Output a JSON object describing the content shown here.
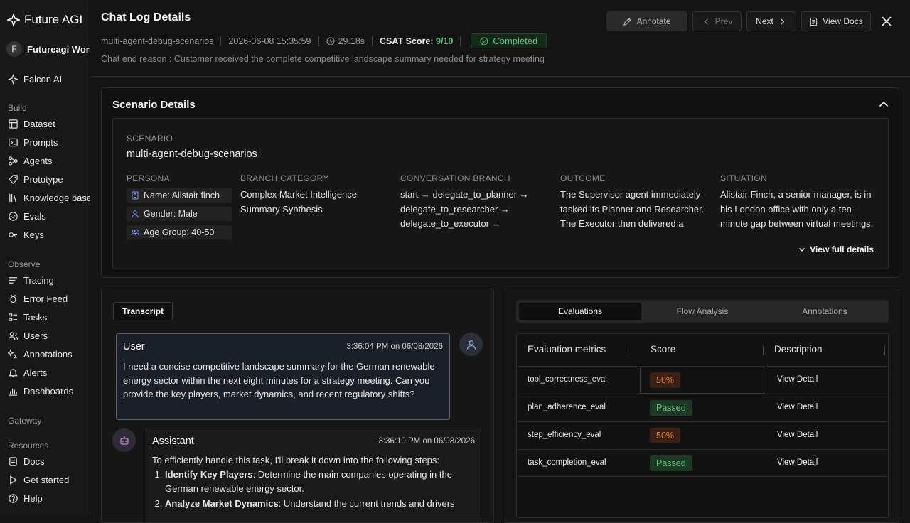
{
  "app": {
    "name": "Future AGI"
  },
  "workspace": {
    "initial": "F",
    "name": "Futureagi Workspace"
  },
  "sidebar": {
    "top_item": "Falcon AI",
    "sections": {
      "build": "Build",
      "observe": "Observe",
      "gateway": "Gateway",
      "resources": "Resources"
    },
    "build_items": [
      "Dataset",
      "Prompts",
      "Agents",
      "Prototype",
      "Knowledge base",
      "Evals",
      "Keys"
    ],
    "observe_items": [
      "Tracing",
      "Error Feed",
      "Tasks",
      "Users",
      "Annotations",
      "Alerts",
      "Dashboards"
    ],
    "resource_items": [
      "Docs",
      "Get started",
      "Help"
    ]
  },
  "header": {
    "title": "Chat Log Details",
    "scenario": "multi-agent-debug-scenarios",
    "datetime": "2026-06-08 15:35:59",
    "duration": "29.18s",
    "csat_label": "CSAT Score:",
    "csat_value": "9/10",
    "status": "Completed",
    "end_reason": "Chat end reason : Customer received the complete competitive landscape summary needed for strategy meeting",
    "annotate": "Annotate",
    "prev": "Prev",
    "next": "Next",
    "view_docs": "View Docs"
  },
  "scenario_details": {
    "title": "Scenario Details",
    "scenario_label": "SCENARIO",
    "scenario_name": "multi-agent-debug-scenarios",
    "persona_label": "PERSONA",
    "persona": {
      "name": "Name: Alistair finch",
      "gender": "Gender: Male",
      "age": "Age Group: 40-50"
    },
    "branch_category_label": "BRANCH CATEGORY",
    "branch_category": "Complex Market Intelligence Summary Synthesis",
    "conversation_branch_label": "CONVERSATION BRANCH",
    "conversation_branch": "start → delegate_to_planner → delegate_to_researcher → delegate_to_executor → synthesize_response →",
    "outcome_label": "OUTCOME",
    "outcome": "The Supervisor agent immediately tasked its Planner and Researcher. The Executor then delivered a concise summary focused on",
    "situation_label": "SITUATION",
    "situation": "Alistair Finch, a senior manager, is in his London office with only a ten-minute gap between virtual meetings. He urgently needs a",
    "view_full": "View full details"
  },
  "transcript": {
    "tab": "Transcript",
    "user": {
      "role": "User",
      "time": "3:36:04 PM on 06/08/2026",
      "text": "I need a concise competitive landscape summary for the German renewable energy sector within the next eight minutes for a strategy meeting. Can you provide the key players, market dynamics, and recent regulatory shifts?"
    },
    "assistant": {
      "role": "Assistant",
      "time": "3:36:10 PM on 06/08/2026",
      "intro": "To efficiently handle this task, I'll break it down into the following steps:",
      "steps": [
        {
          "title": "Identify Key Players",
          "text": ": Determine the main companies operating in the German renewable energy sector."
        },
        {
          "title": "Analyze Market Dynamics",
          "text": ": Understand the current trends and drivers"
        }
      ]
    }
  },
  "evaluations": {
    "tabs": [
      "Evaluations",
      "Flow Analysis",
      "Annotations"
    ],
    "headers": {
      "metric": "Evaluation metrics",
      "score": "Score",
      "description": "Description"
    },
    "rows": [
      {
        "metric": "tool_correctness_eval",
        "score": "50%",
        "status": "warn",
        "detail": "View Detail"
      },
      {
        "metric": "plan_adherence_eval",
        "score": "Passed",
        "status": "pass",
        "detail": "View Detail"
      },
      {
        "metric": "step_efficiency_eval",
        "score": "50%",
        "status": "warn",
        "detail": "View Detail"
      },
      {
        "metric": "task_completion_eval",
        "score": "Passed",
        "status": "pass",
        "detail": "View Detail"
      }
    ]
  },
  "colors": {
    "success": "#5ec27a",
    "warning": "#e07e4a"
  }
}
